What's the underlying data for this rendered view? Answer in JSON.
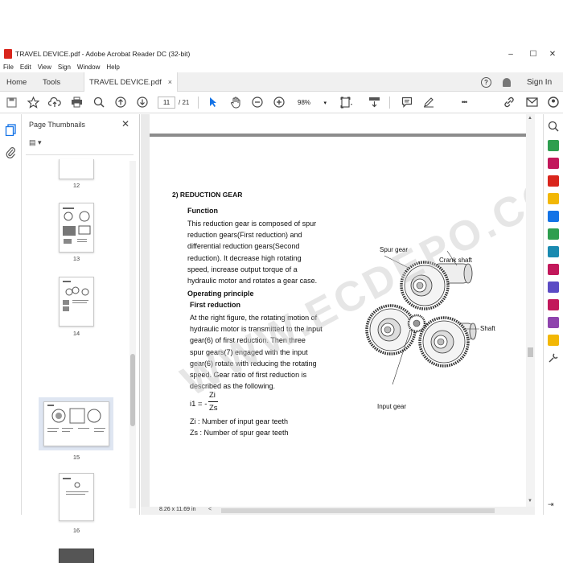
{
  "window": {
    "title": "TRAVEL DEVICE.pdf - Adobe Acrobat Reader DC (32-bit)",
    "minimize": "–",
    "maximize": "☐",
    "close": "✕"
  },
  "menu": [
    "File",
    "Edit",
    "View",
    "Sign",
    "Window",
    "Help"
  ],
  "tabs": {
    "home": "Home",
    "tools": "Tools",
    "document": "TRAVEL DEVICE.pdf",
    "close": "×",
    "help": "?",
    "sign_in": "Sign In"
  },
  "toolbar": {
    "current_page": "11",
    "total_pages": "/ 21",
    "zoom": "98%",
    "more": "•••"
  },
  "thumbnails": {
    "title": "Page Thumbnails",
    "close": "✕",
    "options": "▤ ▾",
    "pages": [
      "12",
      "13",
      "14",
      "15",
      "16"
    ]
  },
  "document": {
    "section": "2)  REDUCTION GEAR",
    "function_heading": "Function",
    "function_lines": [
      "This reduction gear is composed of spur",
      "reduction gears(First reduction) and",
      "differential reduction gears(Second",
      "reduction).  It decrease high rotating",
      "speed, increase output torque of a",
      "hydraulic motor and rotates a gear case."
    ],
    "operating_heading": "Operating principle",
    "first_reduction_heading": "First reduction",
    "first_reduction_lines": [
      "At the right figure, the rotating motion of",
      "hydraulic motor is transmitted to the input",
      "gear(6) of first reduction.   Then three",
      "spur gears(7) engaged with the input",
      "gear(6) rotate with reducing the rotating",
      "speed.   Gear ratio of first reduction is",
      "described as the following."
    ],
    "formula_lhs": "i1 = -",
    "formula_num": "Zi",
    "formula_den": "Zs",
    "def_zi": "Zi  : Number of input gear teeth",
    "def_zs": "Zs : Number of spur gear teeth",
    "figure_labels": {
      "spur_gear": "Spur gear",
      "crank_shaft": "Crank shaft",
      "shaft": "Shaft",
      "input_gear": "Input gear"
    },
    "watermark": "WWW.ECDEPO.COM"
  },
  "status": {
    "page_size": "8.26 x 11.69 in",
    "scroll_left": "<"
  },
  "colors": {
    "acrobat_red": "#d9251c",
    "tool_blue": "#1473e6",
    "tool_magenta": "#c2185b",
    "tool_green": "#2e9e4f"
  }
}
